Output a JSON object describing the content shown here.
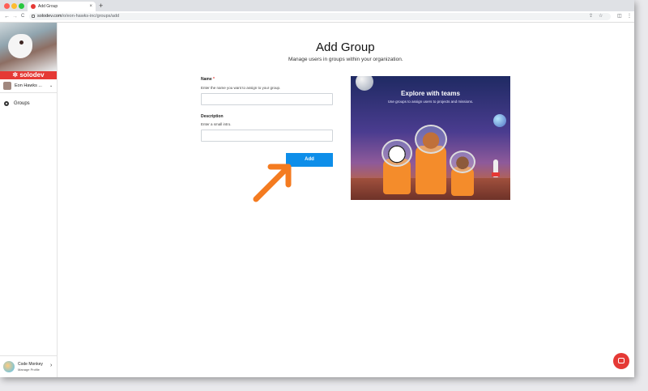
{
  "browser": {
    "tab_title": "Add Group",
    "tab_close": "×",
    "new_tab": "+",
    "url_host": "solodev.com",
    "url_path": "/o/eon-hawks-inc/groups/add",
    "back": "←",
    "forward": "→",
    "reload": "C"
  },
  "sidebar": {
    "brand": "solodev",
    "org_name": "Eon Hawks ...",
    "org_chevron": "⌄",
    "nav_items": [
      {
        "label": "Groups"
      }
    ],
    "profile": {
      "name": "Code Monkey",
      "link": "Manage Profile",
      "chevron": "›"
    }
  },
  "main": {
    "title": "Add Group",
    "subtitle": "Manage users in groups within your organization.",
    "name_field": {
      "label": "Name",
      "required_mark": "*",
      "hint": "Enter the name you want to assign to your group.",
      "value": "",
      "placeholder": ""
    },
    "description_field": {
      "label": "Description",
      "hint": "Enter a small intro.",
      "value": "",
      "placeholder": ""
    },
    "add_button": "Add"
  },
  "promo": {
    "title": "Explore with teams",
    "subtitle": "Use groups to assign users to projects and missions."
  },
  "colors": {
    "accent": "#0e8ee9",
    "brand": "#e53935",
    "arrow": "#f47b20"
  },
  "icons": [
    "lock-icon",
    "share-icon",
    "star-icon",
    "sidebar-icon",
    "menu-icon",
    "groups-icon",
    "chat-icon"
  ]
}
